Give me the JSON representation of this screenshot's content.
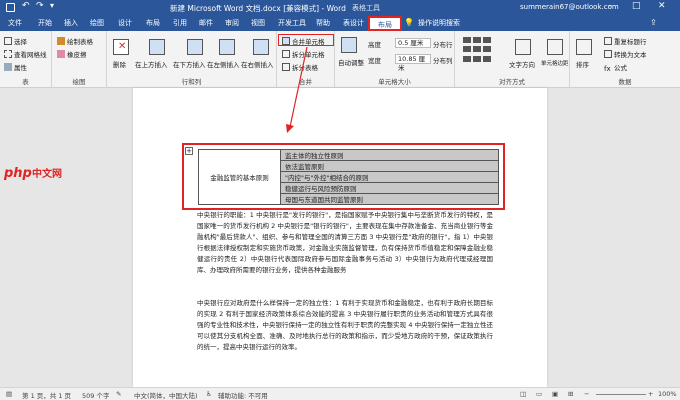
{
  "titlebar": {
    "title": "新建 Microsoft Word 文档.docx [兼容模式] - Word",
    "context_title": "表格工具",
    "account": "summerain67@outlook.com"
  },
  "tabs": [
    "文件",
    "开始",
    "插入",
    "绘图",
    "设计",
    "布局",
    "引用",
    "邮件",
    "审阅",
    "视图",
    "开发工具",
    "帮助",
    "表设计",
    "布局"
  ],
  "active_tab_index": 13,
  "search_placeholder": "操作说明搜索",
  "ribbon": {
    "table_group": {
      "select": "选择",
      "gridlines": "查看网格线",
      "properties": "属性",
      "label": "表"
    },
    "draw_group": {
      "draw_table": "绘制表格",
      "eraser": "橡皮擦",
      "label": "绘图"
    },
    "rows_group": {
      "delete": "删除",
      "above": "在上方插入",
      "below": "在下方插入",
      "left": "在左侧插入",
      "right": "在右侧插入",
      "label": "行和列"
    },
    "merge_group": {
      "merge": "合并单元格",
      "split_cells": "拆分单元格",
      "split_table": "拆分表格",
      "label": "合并"
    },
    "size_group": {
      "autofit": "自动调整",
      "height_label": "高度",
      "height_value": "0.5 厘米",
      "width_label": "宽度",
      "width_value": "10.85 厘米",
      "dist_rows": "分布行",
      "dist_cols": "分布列",
      "label": "单元格大小"
    },
    "align_group": {
      "text_dir": "文字方向",
      "margins": "单元格边距",
      "label": "对齐方式"
    },
    "data_group": {
      "sort": "排序",
      "repeat_header": "重复标题行",
      "convert": "转换为文本",
      "formula": "公式",
      "label": "数据"
    }
  },
  "document": {
    "table": {
      "merged_cell": "金融监管的基本原则",
      "rows": [
        "监主体的独立性原则",
        "依法监管原则",
        "\"内控\"与\"外控\"相结合的原则",
        "稳健运行与风险预防原则",
        "母国与东道国共同监管原则"
      ]
    },
    "paragraph1": "中央银行的职能：1 中央银行是\"发行的银行\"，是指国家赋予中央银行集中与垄断货币发行的特权，是国家唯一的货币发行机构 2 中央银行是\"银行的银行\"，主要表现在集中存款准备金、充当商业银行等金融机构\"最后贷款人\"、组织、参与和管理全国的清算三方面 3 中央银行是\"政府的银行\"，指 1）中央银行根据法律授权制定和实施货币政策，对金融业实施监督管理，负有保持货币币值稳定和保障金融业稳健运行的责任 2）中央银行代表国际政府参与国际金融事务与活动 3）中央银行为政府代理或经理国库、办理政府所需要的银行业务，提供各种金融服务",
    "paragraph2": "中央银行应对政府是什么样保持一定的独立性：1 有利于实现货币和金融稳定，也有利于政府长期目标的实现 2 有利于国家经济政策体系综合效能的提高 3 中央银行履行职责的业务活动和管理方式具有很强的专业性和技术性，中央银行保持一定的独立性有利于职责的完整实现 4 中央银行保持一定独立性还可以使其分支机构全面、准确、及时地执行总行的政策和指示，而少受地方政府的干预，保证政策执行的统一，提高中央银行运行的效率。"
  },
  "statusbar": {
    "page": "第 1 页，共 1 页",
    "words": "509 个字",
    "lang": "中文(简体，中国大陆)",
    "accessibility": "辅助功能: 不可用",
    "zoom": "100%"
  },
  "logo_text": "php中文网"
}
